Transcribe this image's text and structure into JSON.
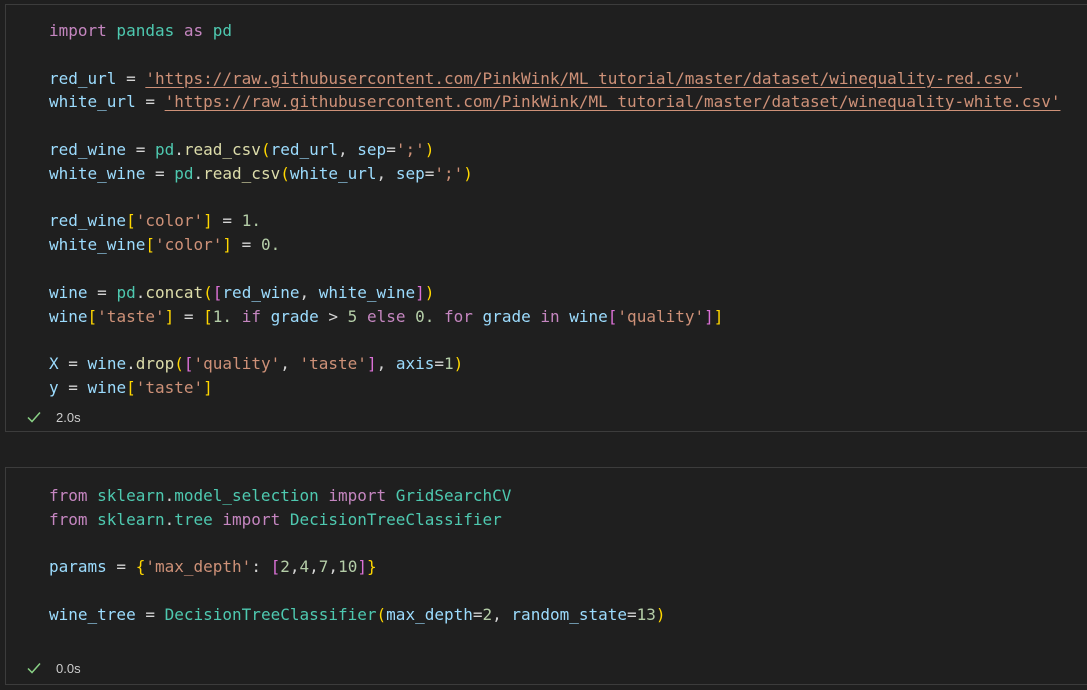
{
  "cells": [
    {
      "lines": [
        [
          {
            "t": "import",
            "c": "k"
          },
          {
            "t": " pandas ",
            "c": "c"
          },
          {
            "t": "as",
            "c": "k"
          },
          {
            "t": " pd",
            "c": "c"
          }
        ],
        [],
        [
          {
            "t": "red_url",
            "c": "v"
          },
          {
            "t": " = ",
            "c": "o"
          },
          {
            "t": "'https://raw.githubusercontent.com/PinkWink/ML_tutorial/master/dataset/winequality-red.csv'",
            "c": "s u"
          }
        ],
        [
          {
            "t": "white_url",
            "c": "v"
          },
          {
            "t": " = ",
            "c": "o"
          },
          {
            "t": "'https://raw.githubusercontent.com/PinkWink/ML_tutorial/master/dataset/winequality-white.csv'",
            "c": "s u"
          }
        ],
        [],
        [
          {
            "t": "red_wine",
            "c": "v"
          },
          {
            "t": " = ",
            "c": "o"
          },
          {
            "t": "pd",
            "c": "c"
          },
          {
            "t": ".",
            "c": "o"
          },
          {
            "t": "read_csv",
            "c": "f"
          },
          {
            "t": "(",
            "c": "b1"
          },
          {
            "t": "red_url",
            "c": "v"
          },
          {
            "t": ", ",
            "c": "o"
          },
          {
            "t": "sep",
            "c": "v"
          },
          {
            "t": "=",
            "c": "o"
          },
          {
            "t": "';'",
            "c": "s"
          },
          {
            "t": ")",
            "c": "b1"
          }
        ],
        [
          {
            "t": "white_wine",
            "c": "v"
          },
          {
            "t": " = ",
            "c": "o"
          },
          {
            "t": "pd",
            "c": "c"
          },
          {
            "t": ".",
            "c": "o"
          },
          {
            "t": "read_csv",
            "c": "f"
          },
          {
            "t": "(",
            "c": "b1"
          },
          {
            "t": "white_url",
            "c": "v"
          },
          {
            "t": ", ",
            "c": "o"
          },
          {
            "t": "sep",
            "c": "v"
          },
          {
            "t": "=",
            "c": "o"
          },
          {
            "t": "';'",
            "c": "s"
          },
          {
            "t": ")",
            "c": "b1"
          }
        ],
        [],
        [
          {
            "t": "red_wine",
            "c": "v"
          },
          {
            "t": "[",
            "c": "b1"
          },
          {
            "t": "'color'",
            "c": "s"
          },
          {
            "t": "]",
            "c": "b1"
          },
          {
            "t": " = ",
            "c": "o"
          },
          {
            "t": "1.",
            "c": "n"
          }
        ],
        [
          {
            "t": "white_wine",
            "c": "v"
          },
          {
            "t": "[",
            "c": "b1"
          },
          {
            "t": "'color'",
            "c": "s"
          },
          {
            "t": "]",
            "c": "b1"
          },
          {
            "t": " = ",
            "c": "o"
          },
          {
            "t": "0.",
            "c": "n"
          }
        ],
        [],
        [
          {
            "t": "wine",
            "c": "v"
          },
          {
            "t": " = ",
            "c": "o"
          },
          {
            "t": "pd",
            "c": "c"
          },
          {
            "t": ".",
            "c": "o"
          },
          {
            "t": "concat",
            "c": "f"
          },
          {
            "t": "(",
            "c": "b1"
          },
          {
            "t": "[",
            "c": "b2"
          },
          {
            "t": "red_wine",
            "c": "v"
          },
          {
            "t": ", ",
            "c": "o"
          },
          {
            "t": "white_wine",
            "c": "v"
          },
          {
            "t": "]",
            "c": "b2"
          },
          {
            "t": ")",
            "c": "b1"
          }
        ],
        [
          {
            "t": "wine",
            "c": "v"
          },
          {
            "t": "[",
            "c": "b1"
          },
          {
            "t": "'taste'",
            "c": "s"
          },
          {
            "t": "]",
            "c": "b1"
          },
          {
            "t": " = ",
            "c": "o"
          },
          {
            "t": "[",
            "c": "b1"
          },
          {
            "t": "1.",
            "c": "n"
          },
          {
            "t": " if ",
            "c": "k"
          },
          {
            "t": "grade",
            "c": "v"
          },
          {
            "t": " > ",
            "c": "o"
          },
          {
            "t": "5",
            "c": "n"
          },
          {
            "t": " else ",
            "c": "k"
          },
          {
            "t": "0.",
            "c": "n"
          },
          {
            "t": " for ",
            "c": "k"
          },
          {
            "t": "grade",
            "c": "v"
          },
          {
            "t": " in ",
            "c": "k"
          },
          {
            "t": "wine",
            "c": "v"
          },
          {
            "t": "[",
            "c": "b2"
          },
          {
            "t": "'quality'",
            "c": "s"
          },
          {
            "t": "]",
            "c": "b2"
          },
          {
            "t": "]",
            "c": "b1"
          }
        ],
        [],
        [
          {
            "t": "X",
            "c": "v"
          },
          {
            "t": " = ",
            "c": "o"
          },
          {
            "t": "wine",
            "c": "v"
          },
          {
            "t": ".",
            "c": "o"
          },
          {
            "t": "drop",
            "c": "f"
          },
          {
            "t": "(",
            "c": "b1"
          },
          {
            "t": "[",
            "c": "b2"
          },
          {
            "t": "'quality'",
            "c": "s"
          },
          {
            "t": ", ",
            "c": "o"
          },
          {
            "t": "'taste'",
            "c": "s"
          },
          {
            "t": "]",
            "c": "b2"
          },
          {
            "t": ", ",
            "c": "o"
          },
          {
            "t": "axis",
            "c": "v"
          },
          {
            "t": "=",
            "c": "o"
          },
          {
            "t": "1",
            "c": "n"
          },
          {
            "t": ")",
            "c": "b1"
          }
        ],
        [
          {
            "t": "y",
            "c": "v"
          },
          {
            "t": " = ",
            "c": "o"
          },
          {
            "t": "wine",
            "c": "v"
          },
          {
            "t": "[",
            "c": "b1"
          },
          {
            "t": "'taste'",
            "c": "s"
          },
          {
            "t": "]",
            "c": "b1"
          }
        ]
      ],
      "status": {
        "time": "2.0s",
        "icon": "check-icon",
        "color": "#89d185"
      }
    },
    {
      "lines": [
        [
          {
            "t": "from",
            "c": "k"
          },
          {
            "t": " sklearn",
            "c": "c"
          },
          {
            "t": ".",
            "c": "o"
          },
          {
            "t": "model_selection ",
            "c": "c"
          },
          {
            "t": "import",
            "c": "k"
          },
          {
            "t": " GridSearchCV",
            "c": "c"
          }
        ],
        [
          {
            "t": "from",
            "c": "k"
          },
          {
            "t": " sklearn",
            "c": "c"
          },
          {
            "t": ".",
            "c": "o"
          },
          {
            "t": "tree ",
            "c": "c"
          },
          {
            "t": "import",
            "c": "k"
          },
          {
            "t": " DecisionTreeClassifier",
            "c": "c"
          }
        ],
        [],
        [
          {
            "t": "params",
            "c": "v"
          },
          {
            "t": " = ",
            "c": "o"
          },
          {
            "t": "{",
            "c": "b1"
          },
          {
            "t": "'max_depth'",
            "c": "s"
          },
          {
            "t": ": ",
            "c": "o"
          },
          {
            "t": "[",
            "c": "b2"
          },
          {
            "t": "2",
            "c": "n"
          },
          {
            "t": ",",
            "c": "o"
          },
          {
            "t": "4",
            "c": "n"
          },
          {
            "t": ",",
            "c": "o"
          },
          {
            "t": "7",
            "c": "n"
          },
          {
            "t": ",",
            "c": "o"
          },
          {
            "t": "10",
            "c": "n"
          },
          {
            "t": "]",
            "c": "b2"
          },
          {
            "t": "}",
            "c": "b1"
          }
        ],
        [],
        [
          {
            "t": "wine_tree",
            "c": "v"
          },
          {
            "t": " = ",
            "c": "o"
          },
          {
            "t": "DecisionTreeClassifier",
            "c": "c"
          },
          {
            "t": "(",
            "c": "b1"
          },
          {
            "t": "max_depth",
            "c": "v"
          },
          {
            "t": "=",
            "c": "o"
          },
          {
            "t": "2",
            "c": "n"
          },
          {
            "t": ", ",
            "c": "o"
          },
          {
            "t": "random_state",
            "c": "v"
          },
          {
            "t": "=",
            "c": "o"
          },
          {
            "t": "13",
            "c": "n"
          },
          {
            "t": ")",
            "c": "b1"
          }
        ]
      ],
      "status": {
        "time": "0.0s",
        "icon": "check-icon",
        "color": "#89d185"
      }
    }
  ]
}
